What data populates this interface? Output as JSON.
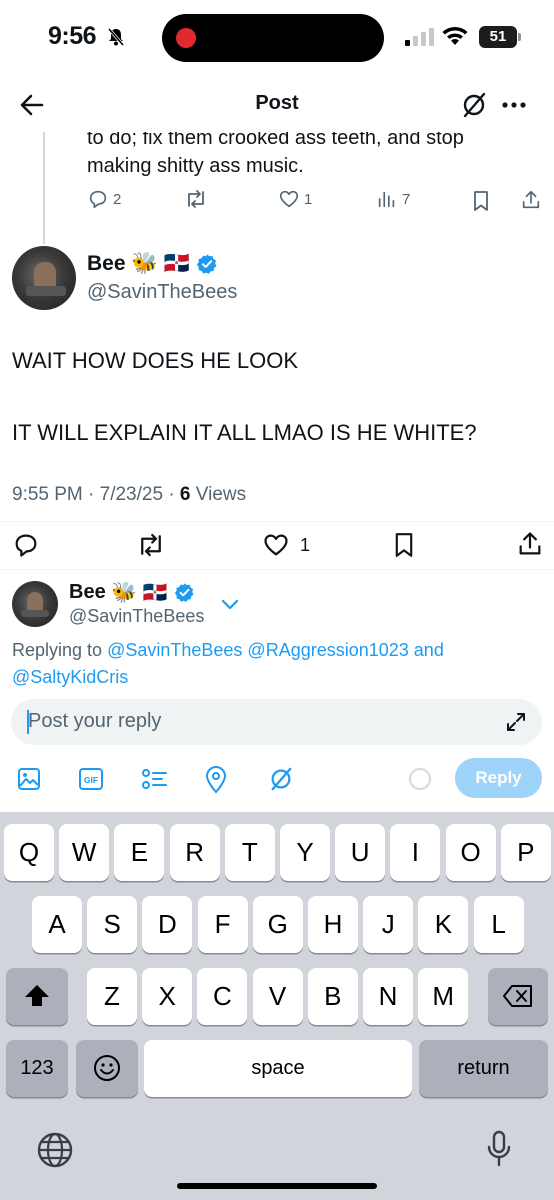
{
  "status": {
    "time": "9:56",
    "battery": "51"
  },
  "nav": {
    "title": "Post"
  },
  "prev_tweet": {
    "text": "to do; fix them crooked ass teeth, and stop making shitty ass music.",
    "replies": "2",
    "likes": "1",
    "views": "7"
  },
  "tweet": {
    "author_name": "Bee",
    "author_emoji": "🐝",
    "flag": "🇩🇴",
    "handle": "@SavinTheBees",
    "line1": "WAIT HOW DOES HE LOOK",
    "line2": "IT WILL EXPLAIN IT ALL LMAO IS HE WHITE?",
    "time": "9:55 PM · 7/23/25 · ",
    "views_count": "6",
    "views_label": " Views",
    "likes": "1"
  },
  "composer": {
    "name": "Bee",
    "handle": "@SavinTheBees",
    "replying_prefix": "Replying to ",
    "replying_to_1": "@SavinTheBees",
    "replying_to_2": "@RAggression1023",
    "replying_and": " and",
    "replying_to_3": "@SaltyKidCris",
    "placeholder": "Post your reply",
    "reply_button": "Reply"
  },
  "keyboard": {
    "row1": [
      "Q",
      "W",
      "E",
      "R",
      "T",
      "Y",
      "U",
      "I",
      "O",
      "P"
    ],
    "row2": [
      "A",
      "S",
      "D",
      "F",
      "G",
      "H",
      "J",
      "K",
      "L"
    ],
    "row3": [
      "Z",
      "X",
      "C",
      "V",
      "B",
      "N",
      "M"
    ],
    "numbers": "123",
    "space": "space",
    "return": "return"
  },
  "colors": {
    "accent": "#1d9bf0",
    "muted": "#536471",
    "keyboard_bg": "#d1d4da"
  }
}
